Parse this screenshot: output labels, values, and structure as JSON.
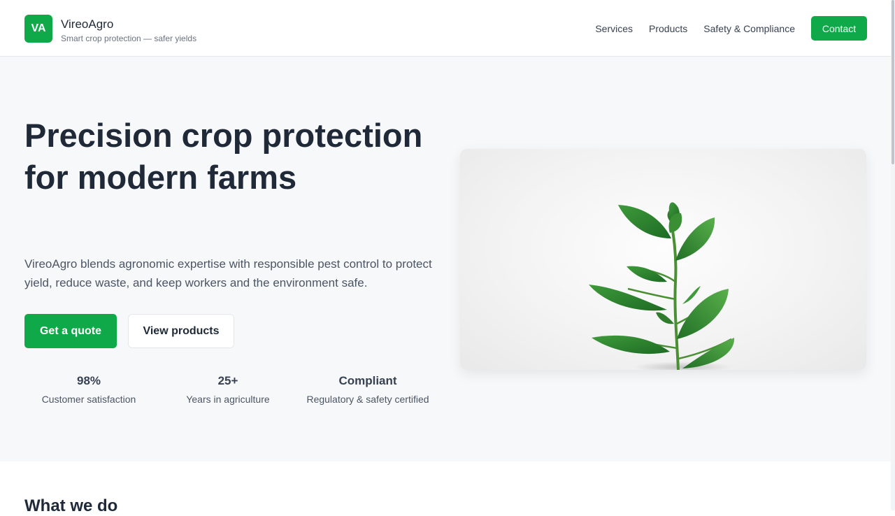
{
  "brand": {
    "badge": "VA",
    "name": "VireoAgro",
    "tagline": "Smart crop protection — safer yields"
  },
  "nav": {
    "items": [
      "Services",
      "Products",
      "Safety & Compliance"
    ],
    "contact": "Contact"
  },
  "hero": {
    "title": "Precision crop protection for modern farms",
    "subtitle": "VireoAgro blends agronomic expertise with responsible pest control to protect yield, reduce waste, and keep workers and the environment safe.",
    "primary_cta": "Get a quote",
    "secondary_cta": "View products",
    "image_icon": "plant-photo",
    "stats": [
      {
        "value": "98%",
        "label": "Customer satisfaction"
      },
      {
        "value": "25+",
        "label": "Years in agriculture"
      },
      {
        "value": "Compliant",
        "label": "Regulatory & safety certified"
      }
    ]
  },
  "section": {
    "title": "What we do"
  },
  "colors": {
    "accent": "#10a94a",
    "text": "#1f2937",
    "hero_bg": "#f7f8fa"
  }
}
